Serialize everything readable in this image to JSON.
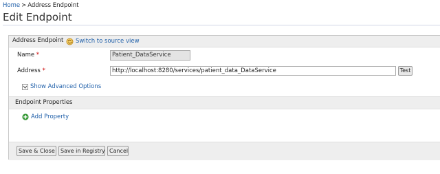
{
  "breadcrumb": {
    "home": "Home",
    "separator": ">",
    "current": "Address Endpoint"
  },
  "page": {
    "title": "Edit Endpoint"
  },
  "panel": {
    "title": "Address Endpoint",
    "switch_link": "Switch to source view",
    "fields": {
      "name_label": "Name",
      "name_value": "Patient_DataService",
      "address_label": "Address",
      "address_value": "http://localhost:8280/services/patient_data_DataService",
      "required_mark": "*",
      "test_label": "Test"
    },
    "advanced": {
      "label": "Show Advanced Options",
      "icon": "chevron-down-icon"
    },
    "endpoint_properties": {
      "title": "Endpoint Properties",
      "add_label": "Add Property",
      "add_icon": "plus-circle-icon"
    },
    "buttons": {
      "save_close": "Save & Close",
      "save_registry": "Save in Registry",
      "cancel": "Cancel"
    }
  },
  "colors": {
    "link": "#1f5fa9",
    "required": "#cc0000",
    "header_bg": "#eeeeee",
    "add_icon": "#3a9a3a"
  }
}
